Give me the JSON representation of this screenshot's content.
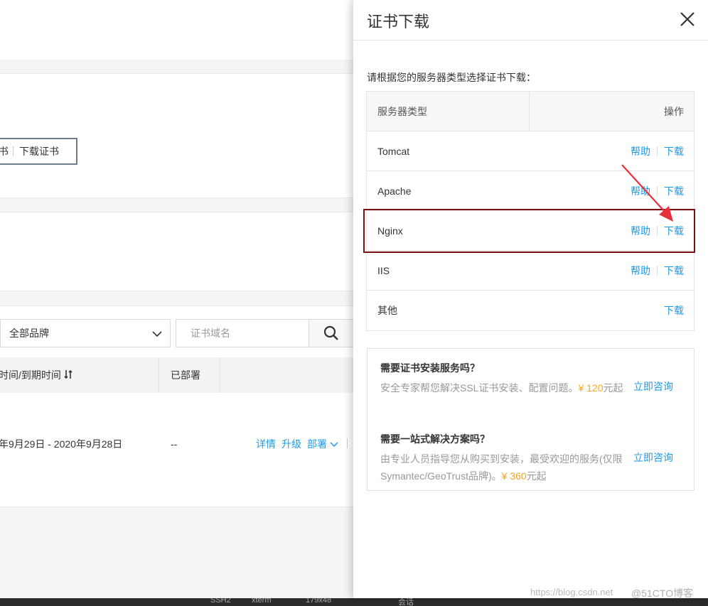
{
  "background": {
    "card1_button": {
      "left_label": "书",
      "right_label": "下载证书"
    },
    "filters": {
      "brand_selected": "全部品牌",
      "domain_placeholder": "证书域名"
    },
    "table": {
      "headers": {
        "time": "时间/到期时间",
        "deployed": "已部署"
      },
      "row": {
        "dates": "年9月29日 - 2020年9月28日",
        "deployed": "--",
        "actions": {
          "details": "详情",
          "upgrade": "升级",
          "deploy": "部署"
        }
      }
    },
    "taskbar": [
      "SSH2",
      "xterm",
      "179x48",
      "会话"
    ]
  },
  "drawer": {
    "title": "证书下载",
    "prompt": "请根据您的服务器类型选择证书下载：",
    "table": {
      "headers": {
        "type": "服务器类型",
        "operation": "操作"
      },
      "rows": [
        {
          "name": "Tomcat",
          "help": "帮助",
          "download": "下载"
        },
        {
          "name": "Apache",
          "help": "帮助",
          "download": "下载"
        },
        {
          "name": "Nginx",
          "help": "帮助",
          "download": "下载"
        },
        {
          "name": "IIS",
          "help": "帮助",
          "download": "下载"
        },
        {
          "name": "其他",
          "download": "下载"
        }
      ]
    },
    "services": [
      {
        "title": "需要证书安装服务吗？",
        "desc_before": "安全专家帮您解决SSL证书安装、配置问题。",
        "price": "¥ 120",
        "desc_after": "元起",
        "link": "立即咨询"
      },
      {
        "title": "需要一站式解决方案吗？",
        "desc_before": "由专业人员指导您从购买到安装，最受欢迎的服务(仅限Symantec/GeoTrust品牌)。",
        "price": "¥ 360",
        "desc_after": "元起",
        "link": "立即咨询"
      }
    ]
  },
  "watermark": {
    "url": "https://blog.csdn.net",
    "brand": "@51CTO博客"
  },
  "colors": {
    "link": "#1e9be6",
    "price": "#f5a623",
    "highlight": "#7a0f18",
    "arrow": "#e8303a"
  }
}
